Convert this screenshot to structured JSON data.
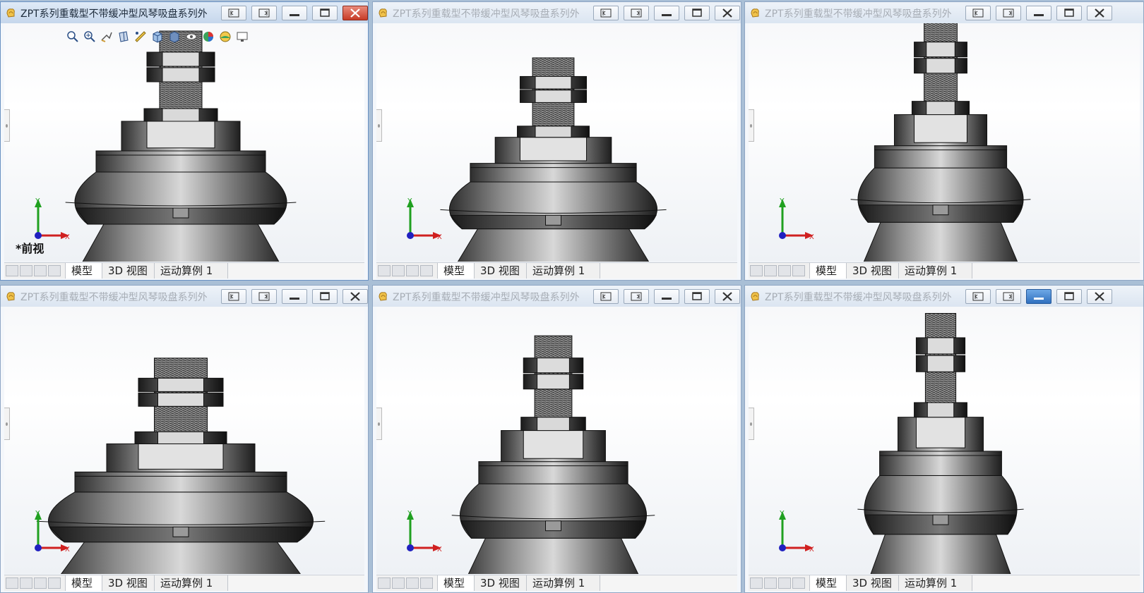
{
  "windows": [
    {
      "title": "ZPT系列重载型不带缓冲型风琴吸盘系列外",
      "active": true,
      "view_label": "*前视",
      "tabs": [
        "模型",
        "3D 视图",
        "运动算例 1"
      ]
    },
    {
      "title": "ZPT系列重载型不带缓冲型风琴吸盘系列外",
      "active": false,
      "tabs": [
        "模型",
        "3D 视图",
        "运动算例 1"
      ]
    },
    {
      "title": "ZPT系列重载型不带缓冲型风琴吸盘系列外",
      "active": false,
      "tabs": [
        "模型",
        "3D 视图",
        "运动算例 1"
      ]
    },
    {
      "title": "ZPT系列重载型不带缓冲型风琴吸盘系列外",
      "active": false,
      "tabs": [
        "模型",
        "3D 视图",
        "运动算例 1"
      ]
    },
    {
      "title": "ZPT系列重载型不带缓冲型风琴吸盘系列外",
      "active": false,
      "tabs": [
        "模型",
        "3D 视图",
        "运动算例 1"
      ]
    },
    {
      "title": "ZPT系列重载型不带缓冲型风琴吸盘系列外",
      "active": false,
      "tabs": [
        "模型",
        "3D 视图",
        "运动算例 1"
      ]
    }
  ],
  "triad": {
    "x_label": "X",
    "y_label": "Y"
  },
  "icons": {
    "app": "solidworks-part-icon",
    "title_buttons": [
      "tile-left-icon",
      "tile-right-icon",
      "minimize-icon",
      "restore-icon",
      "close-icon"
    ],
    "heads_up_toolbar": [
      "zoom-to-fit-icon",
      "zoom-to-area-icon",
      "previous-view-icon",
      "section-view-icon",
      "dynamic-annotation-icon",
      "view-orientation-icon",
      "display-style-icon",
      "hide-show-items-icon",
      "edit-appearance-icon",
      "apply-scene-icon",
      "view-settings-icon"
    ],
    "task_pane": [
      "home-icon",
      "design-library-icon",
      "file-explorer-icon",
      "view-palette-icon",
      "appearances-icon",
      "custom-properties-icon",
      "forum-icon"
    ]
  },
  "colors": {
    "active_close": "#c73b27",
    "accent_minimize": "#2f6fbf",
    "triad_x": "#d02020",
    "triad_y": "#20a020",
    "triad_z": "#2020c0"
  }
}
